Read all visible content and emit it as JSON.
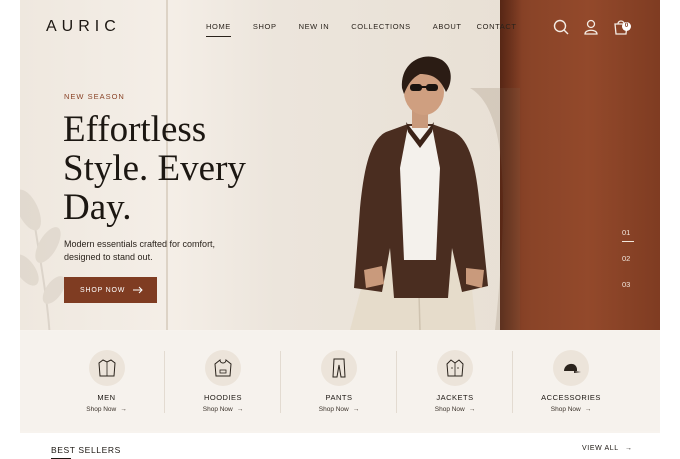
{
  "brand": {
    "logo": "AURIC"
  },
  "nav": {
    "links": [
      "HOME",
      "SHOP",
      "NEW IN",
      "COLLECTIONS",
      "ABOUT",
      "CONTACT"
    ],
    "active": "HOME",
    "cart_count": "0",
    "icons": [
      "search-icon",
      "user-icon",
      "bag-icon"
    ]
  },
  "hero": {
    "eyebrow": "NEW SEASON",
    "headline": [
      "Effortless",
      "Style. Every",
      "Day."
    ],
    "subcopy": "Modern essentials crafted for comfort, designed to stand out.",
    "cta": "SHOP NOW",
    "slides": [
      "01",
      "02",
      "03"
    ],
    "active_slide": "01"
  },
  "categories": [
    {
      "name": "MEN",
      "link": "Shop Now",
      "icon": "shirt-icon"
    },
    {
      "name": "HOODIES",
      "link": "Shop Now",
      "icon": "hoodie-icon"
    },
    {
      "name": "PANTS",
      "link": "Shop Now",
      "icon": "pants-icon"
    },
    {
      "name": "JACKETS",
      "link": "Shop Now",
      "icon": "jacket-icon"
    },
    {
      "name": "ACCESSORIES",
      "link": "Shop Now",
      "icon": "cap-icon"
    }
  ],
  "best_sellers": {
    "title": "BEST SELLERS",
    "view_all": "VIEW ALL"
  },
  "colors": {
    "accent": "#7f3c22",
    "background": "#f7f3ee",
    "text": "#1c1712"
  }
}
